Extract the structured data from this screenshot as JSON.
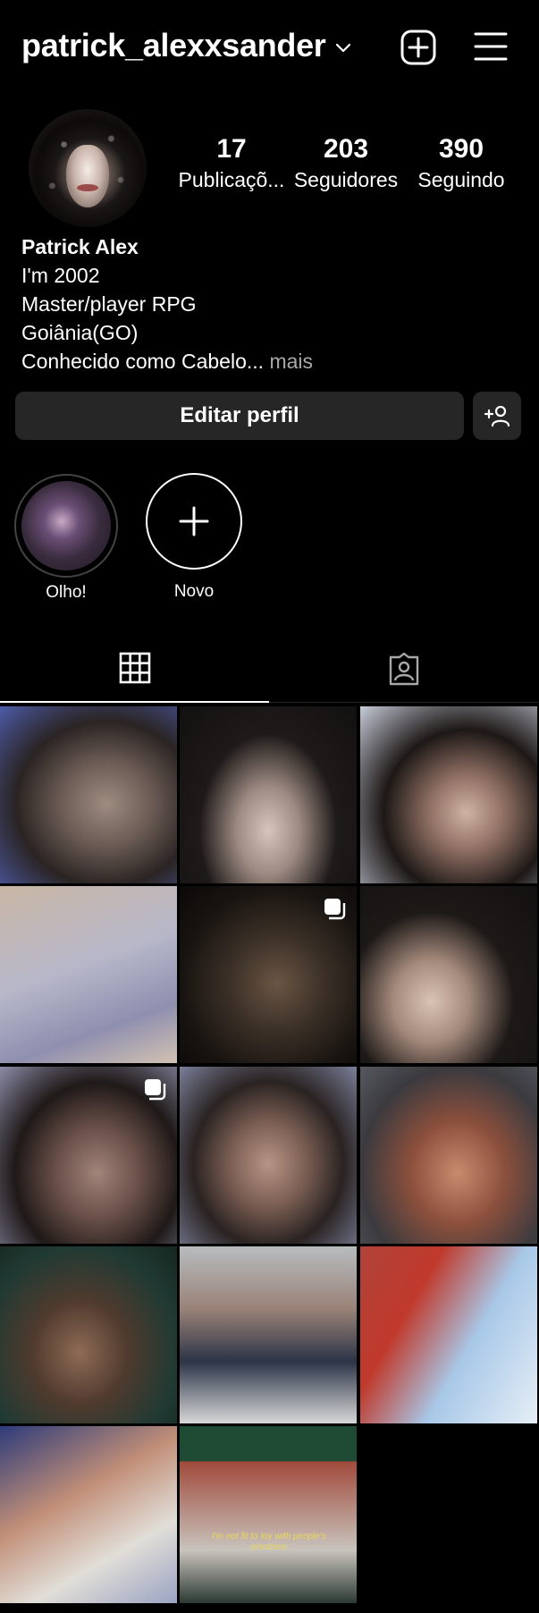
{
  "header": {
    "username": "patrick_alexxsander",
    "add_icon": "plus-square-icon",
    "menu_icon": "hamburger-menu-icon"
  },
  "profile": {
    "stats": [
      {
        "value": "17",
        "label": "Publicaçõ..."
      },
      {
        "value": "203",
        "label": "Seguidores"
      },
      {
        "value": "390",
        "label": "Seguindo"
      }
    ],
    "name": "Patrick Alex",
    "bio_lines": [
      "I'm 2002",
      "Master/player RPG",
      "Goiânia(GO)"
    ],
    "bio_last": "Conhecido como Cabelo...",
    "more_label": "mais"
  },
  "actions": {
    "edit_label": "Editar perfil",
    "discover_icon": "add-person-icon"
  },
  "highlights": [
    {
      "label": "Olho!"
    },
    {
      "label": "Novo"
    }
  ],
  "tabs": [
    {
      "name": "grid",
      "icon": "grid-icon",
      "active": true
    },
    {
      "name": "tagged",
      "icon": "tagged-person-icon",
      "active": false
    }
  ],
  "posts": [
    {
      "multi": false
    },
    {
      "multi": false
    },
    {
      "multi": false
    },
    {
      "multi": false
    },
    {
      "multi": true
    },
    {
      "multi": false
    },
    {
      "multi": true
    },
    {
      "multi": false
    },
    {
      "multi": false
    },
    {
      "multi": false
    },
    {
      "multi": false
    },
    {
      "multi": false
    },
    {
      "multi": false
    },
    {
      "multi": false,
      "caption": "I'm not fit to toy with people's emotions"
    }
  ],
  "colors": {
    "background": "#000000",
    "button": "#262626",
    "muted": "#a8a8a8"
  }
}
